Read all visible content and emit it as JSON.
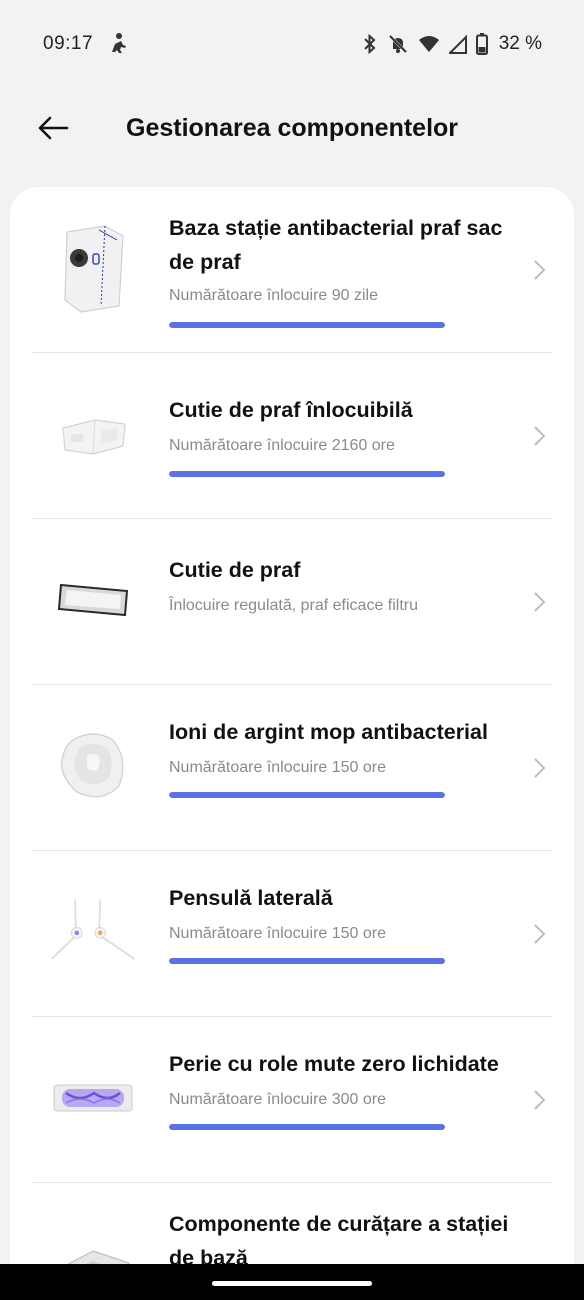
{
  "status_bar": {
    "time": "09:17",
    "battery": "32 %",
    "icons": [
      "accessibility-icon",
      "bluetooth-icon",
      "mute-icon",
      "wifi-icon",
      "signal-icon",
      "battery-icon"
    ]
  },
  "header": {
    "back_icon": "arrow-left-icon",
    "title": "Gestionarea componentelor"
  },
  "colors": {
    "accent": "#5b72e6",
    "background": "#f2f2f2",
    "card": "#ffffff"
  },
  "items": [
    {
      "title": "Baza stație antibacterial praf sac de praf",
      "subtitle": "Numărătoare înlocuire 90 zile",
      "remaining": 1.0,
      "icon": "dust-bag-icon"
    },
    {
      "title": "Cutie de praf înlocuibilă",
      "subtitle": "Numărătoare înlocuire 2160 ore",
      "remaining": 1.0,
      "icon": "dust-box-icon"
    },
    {
      "title": "Cutie de praf",
      "subtitle": "Înlocuire regulată, praf eficace filtru",
      "icon": "filter-icon"
    },
    {
      "title": "Ioni de argint mop antibacterial",
      "subtitle": "Numărătoare înlocuire 150 ore",
      "remaining": 1.0,
      "icon": "mop-pad-icon"
    },
    {
      "title": "Pensulă laterală",
      "subtitle": "Numărătoare înlocuire 150 ore",
      "remaining": 1.0,
      "icon": "side-brush-icon"
    },
    {
      "title": "Perie cu role mute zero lichidate",
      "subtitle": "Numărătoare înlocuire 300 ore",
      "remaining": 1.0,
      "icon": "roller-brush-icon"
    },
    {
      "title": "Componente de curățare a stației de bază",
      "icon": "base-station-tray-icon"
    }
  ]
}
